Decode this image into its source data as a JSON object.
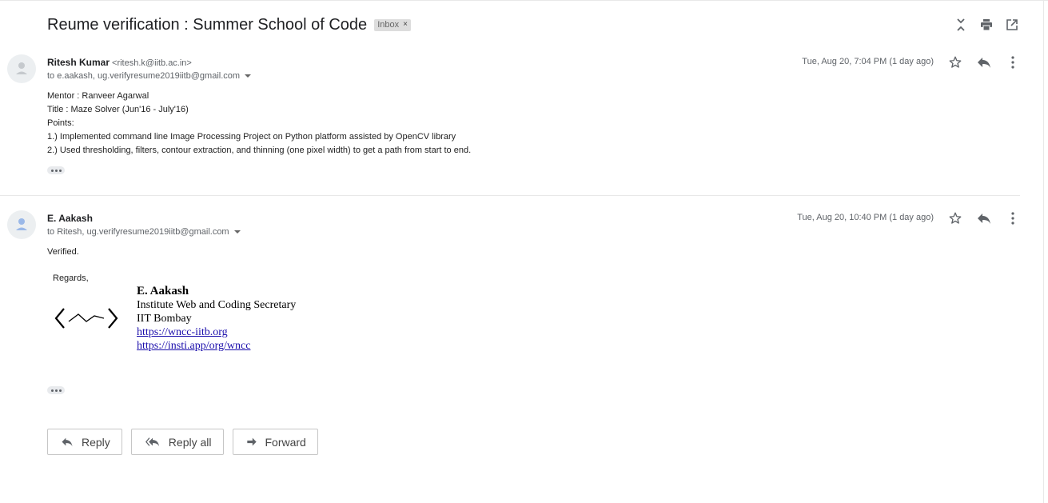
{
  "thread": {
    "subject": "Reume verification : Summer School of Code",
    "label": "Inbox",
    "label_remove": "×"
  },
  "top_icons": [
    "collapse-all-icon",
    "print-icon",
    "open-in-new-window-icon"
  ],
  "messages": [
    {
      "sender_name": "Ritesh Kumar",
      "sender_email": "<ritesh.k@iitb.ac.in>",
      "to": "to e.aakash, ug.verifyresume2019iitb@gmail.com",
      "date": "Tue, Aug 20, 7:04 PM (1 day ago)",
      "body": [
        "Mentor :  Ranveer Agarwal",
        "Title : Maze Solver (Jun'16 - July'16)",
        "Points:",
        "1.) Implemented command line Image Processing Project on Python platform assisted by OpenCV library",
        "2.) Used thresholding, filters, contour extraction, and thinning (one pixel width) to get a path from start to end."
      ]
    },
    {
      "sender_name": "E. Aakash",
      "sender_email": "",
      "to": "to Ritesh, ug.verifyresume2019iitb@gmail.com",
      "date": "Tue, Aug 20, 10:40 PM (1 day ago)",
      "body": [
        "Verified."
      ],
      "regards": "Regards,",
      "signature": {
        "name": "E. Aakash",
        "title": "Institute Web and Coding Secretary",
        "org": "IIT Bombay",
        "link1": "https://wncc-iitb.org",
        "link2": "https://insti.app/org/wncc"
      }
    }
  ],
  "actions": {
    "reply": "Reply",
    "reply_all": "Reply all",
    "forward": "Forward"
  },
  "colors": {
    "link": "#1a0dab",
    "icon": "#5f6368",
    "chip_bg": "#dddddd"
  }
}
